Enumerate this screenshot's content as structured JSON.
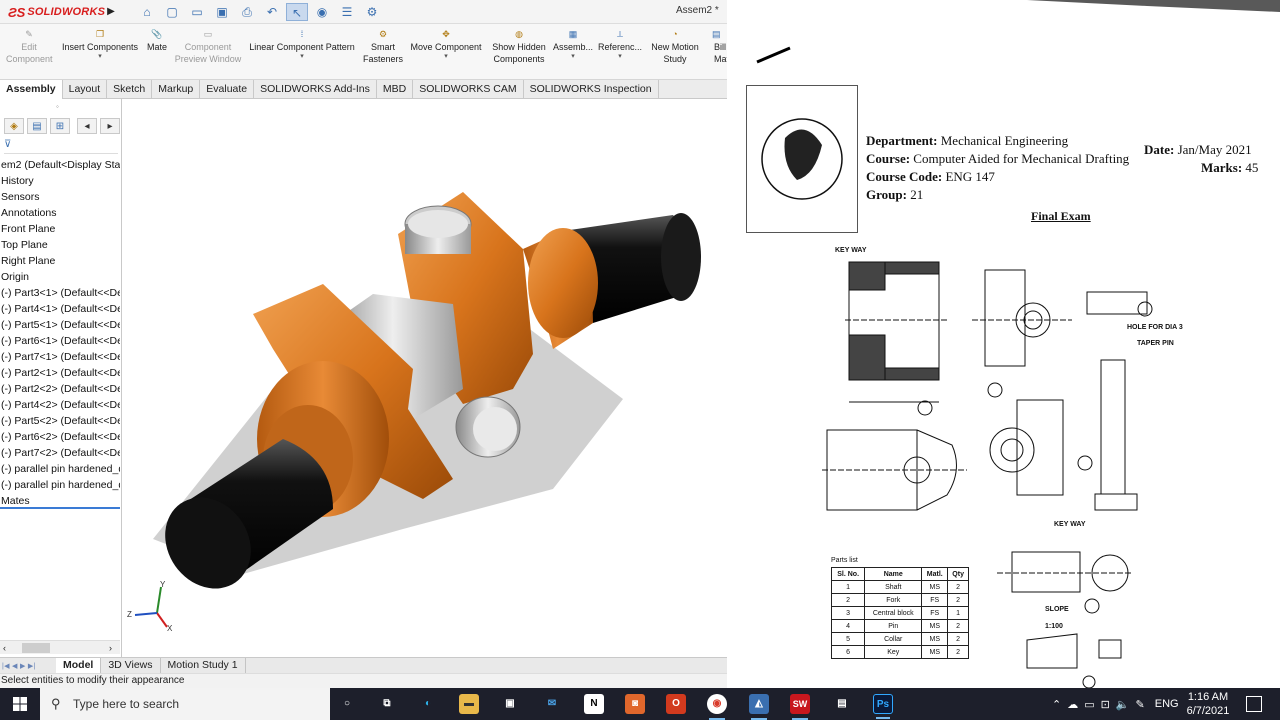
{
  "app": {
    "brand": "SOLIDWORKS",
    "doc_title": "Assem2 *"
  },
  "commands": [
    {
      "id": "edit-component",
      "label": "Edit Component",
      "disabled": true
    },
    {
      "id": "insert-components",
      "label": "Insert Components",
      "disabled": false
    },
    {
      "id": "mate",
      "label": "Mate",
      "disabled": false
    },
    {
      "id": "component-preview",
      "label": "Component Preview Window",
      "disabled": true
    },
    {
      "id": "linear-pattern",
      "label": "Linear Component Pattern",
      "disabled": false
    },
    {
      "id": "smart-fasteners",
      "label": "Smart Fasteners",
      "disabled": false
    },
    {
      "id": "move-component",
      "label": "Move Component",
      "disabled": false
    },
    {
      "id": "show-hidden",
      "label": "Show Hidden Components",
      "disabled": false
    },
    {
      "id": "assembly",
      "label": "Assemb...",
      "disabled": false
    },
    {
      "id": "reference",
      "label": "Referenc...",
      "disabled": false
    },
    {
      "id": "motion-study",
      "label": "New Motion Study",
      "disabled": false
    },
    {
      "id": "bill",
      "label": "Bill Mate",
      "disabled": false
    }
  ],
  "tabs": [
    "Assembly",
    "Layout",
    "Sketch",
    "Markup",
    "Evaluate",
    "SOLIDWORKS Add-Ins",
    "MBD",
    "SOLIDWORKS CAM",
    "SOLIDWORKS Inspection"
  ],
  "tree": [
    "em2  (Default<Display Stat",
    "History",
    "Sensors",
    "Annotations",
    "Front Plane",
    "Top Plane",
    "Right Plane",
    "Origin",
    "(-) Part3<1> (Default<<De",
    "(-) Part4<1> (Default<<De",
    "(-) Part5<1> (Default<<De",
    "(-) Part6<1> (Default<<De",
    "(-) Part7<1> (Default<<De",
    "(-) Part2<1> (Default<<De",
    "(-) Part2<2> (Default<<De",
    "(-) Part4<2> (Default<<De",
    "(-) Part5<2> (Default<<De",
    "(-) Part6<2> (Default<<De",
    "(-) Part7<2> (Default<<De",
    "(-) parallel pin hardened_d",
    "(-) parallel pin hardened_d",
    "Mates"
  ],
  "bottom_tabs": [
    "Model",
    "3D Views",
    "Motion Study 1"
  ],
  "status": "Select entities to modify their appearance",
  "paper": {
    "dept_label": "Department:",
    "dept": "Mechanical Engineering",
    "course_label": "Course:",
    "course": "Computer Aided for Mechanical Drafting",
    "code_label": "Course Code:",
    "code": "ENG 147",
    "group_label": "Group:",
    "group": "21",
    "date_label": "Date:",
    "date": "Jan/May 2021",
    "marks_label": "Marks:",
    "marks": "45",
    "title": "Final Exam",
    "labels": {
      "keyway1": "KEY WAY",
      "keyway2": "KEY WAY",
      "hole": "HOLE FOR DIA 3",
      "taper": "TAPER PIN",
      "slope": "SLOPE",
      "slope_ratio": "1:100"
    },
    "parts_title": "Parts list",
    "parts_headers": [
      "Sl. No.",
      "Name",
      "Matl.",
      "Qty"
    ],
    "parts_rows": [
      [
        "1",
        "Shaft",
        "MS",
        "2"
      ],
      [
        "2",
        "Fork",
        "FS",
        "2"
      ],
      [
        "3",
        "Central block",
        "FS",
        "1"
      ],
      [
        "4",
        "Pin",
        "MS",
        "2"
      ],
      [
        "5",
        "Collar",
        "MS",
        "2"
      ],
      [
        "6",
        "Key",
        "MS",
        "2"
      ]
    ]
  },
  "taskbar": {
    "search_placeholder": "Type here to search",
    "lang": "ENG",
    "time": "1:16 AM",
    "date": "6/7/2021"
  },
  "colors": {
    "orange": "#d8741c",
    "accent": "#3a7bd5",
    "taskbar": "#1d1f2b"
  }
}
